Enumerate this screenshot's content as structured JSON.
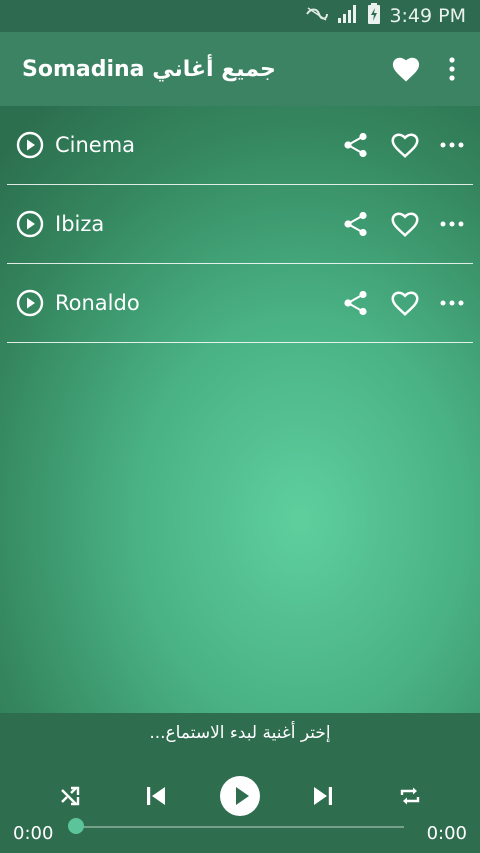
{
  "status_bar": {
    "time": "3:49 PM"
  },
  "app_bar": {
    "title": "Somadina جميع أغاني"
  },
  "songs": [
    {
      "title": "Cinema"
    },
    {
      "title": "Ibiza"
    },
    {
      "title": "Ronaldo"
    }
  ],
  "player": {
    "hint": "إختر أغنية لبدء الاستماع...",
    "elapsed": "0:00",
    "duration": "0:00",
    "progress_fraction": 0
  },
  "colors": {
    "status_bar": "#2e6a4f",
    "app_bar": "#3c8363",
    "player_bar": "#2f6d4f",
    "accent": "#5cc49a"
  }
}
